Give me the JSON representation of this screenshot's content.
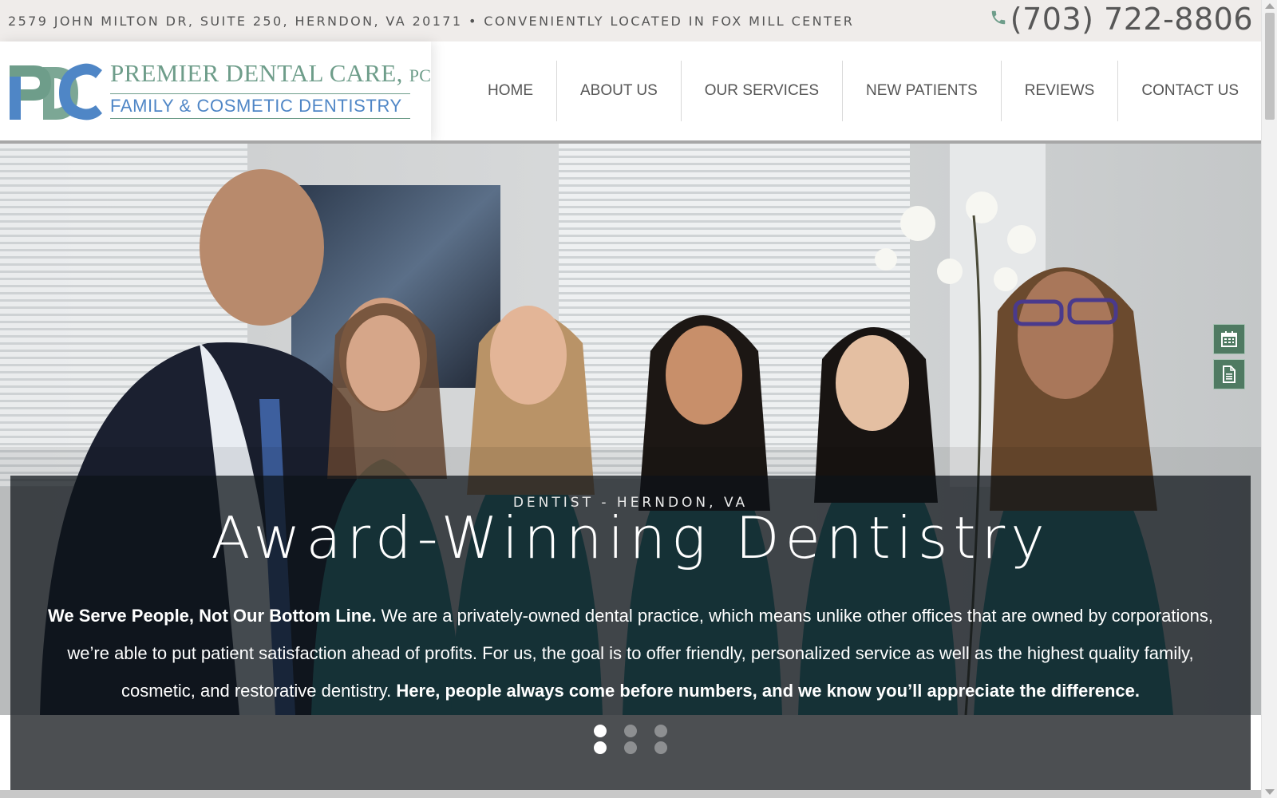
{
  "topbar": {
    "address": "2579 JOHN MILTON DR, SUITE 250, HERNDON, VA 20171 • CONVENIENTLY LOCATED IN FOX MILL CENTER",
    "phone": "(703) 722-8806",
    "phone_icon": "phone-icon"
  },
  "logo": {
    "mark": "PDC",
    "name": "PREMIER DENTAL CARE,",
    "suffix": "PC",
    "tagline": "FAMILY & COSMETIC DENTISTRY",
    "colors": {
      "green": "#6e9d8a",
      "blue": "#4f86c6"
    }
  },
  "nav": {
    "items": [
      {
        "label": "HOME"
      },
      {
        "label": "ABOUT US"
      },
      {
        "label": "OUR SERVICES"
      },
      {
        "label": "NEW PATIENTS"
      },
      {
        "label": "REVIEWS"
      },
      {
        "label": "CONTACT US"
      }
    ]
  },
  "hero": {
    "eyebrow": "DENTIST - HERNDON, VA",
    "headline": "Award-Winning Dentistry",
    "body_lead": "We Serve People, Not Our Bottom Line.",
    "body_text": " We are a privately-owned dental practice, which means unlike other offices that are owned by corporations, we’re able to put patient satisfaction ahead of profits. For us, the goal is to offer friendly, personalized service as well as the highest quality family, cosmetic, and restorative dentistry. ",
    "body_close": "Here, people always come before numbers, and we know you’ll appreciate the difference."
  },
  "side_buttons": [
    {
      "icon": "calendar-icon"
    },
    {
      "icon": "document-icon"
    }
  ],
  "slider": {
    "dots": [
      {
        "active": true
      },
      {
        "active": false
      },
      {
        "active": false
      },
      {
        "active": true
      },
      {
        "active": false
      },
      {
        "active": false
      }
    ]
  },
  "colors": {
    "topbar_bg": "#efecea",
    "accent_green": "#4f7a62",
    "caption_bg": "#0c1218",
    "dots_band": "#4c4f52"
  }
}
